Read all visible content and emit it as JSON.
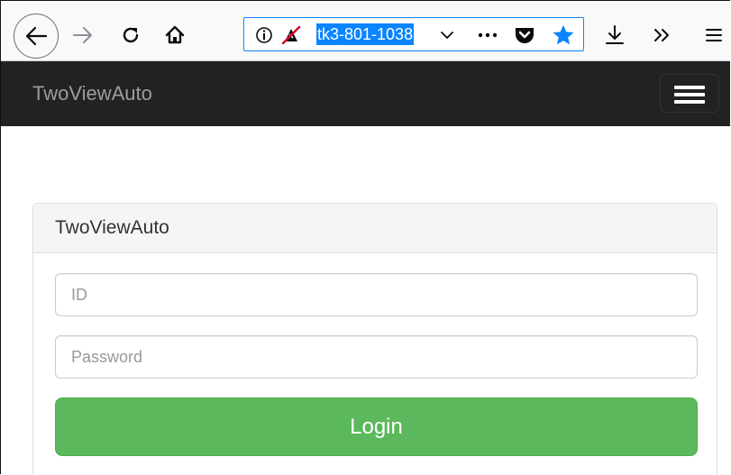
{
  "browser": {
    "url_text": "tk3-801-1038",
    "icons": {
      "back": "back-arrow-icon",
      "forward": "forward-arrow-icon",
      "reload": "reload-icon",
      "home": "home-icon",
      "info": "info-icon",
      "tracking": "tracking-protection-icon",
      "dropdown": "chevron-down-icon",
      "more": "more-actions-icon",
      "pocket": "pocket-icon",
      "bookmark": "star-icon",
      "download": "download-icon",
      "overflow": "overflow-chevrons-icon",
      "menu": "hamburger-menu-icon"
    },
    "colors": {
      "accent": "#0a84ff",
      "star": "#0a84ff"
    }
  },
  "navbar": {
    "brand": "TwoViewAuto",
    "background": "#222222",
    "toggle_icon": "hamburger-menu-icon"
  },
  "login": {
    "title": "TwoViewAuto",
    "id_placeholder": "ID",
    "password_placeholder": "Password",
    "button_label": "Login",
    "button_color": "#5cb85c"
  }
}
